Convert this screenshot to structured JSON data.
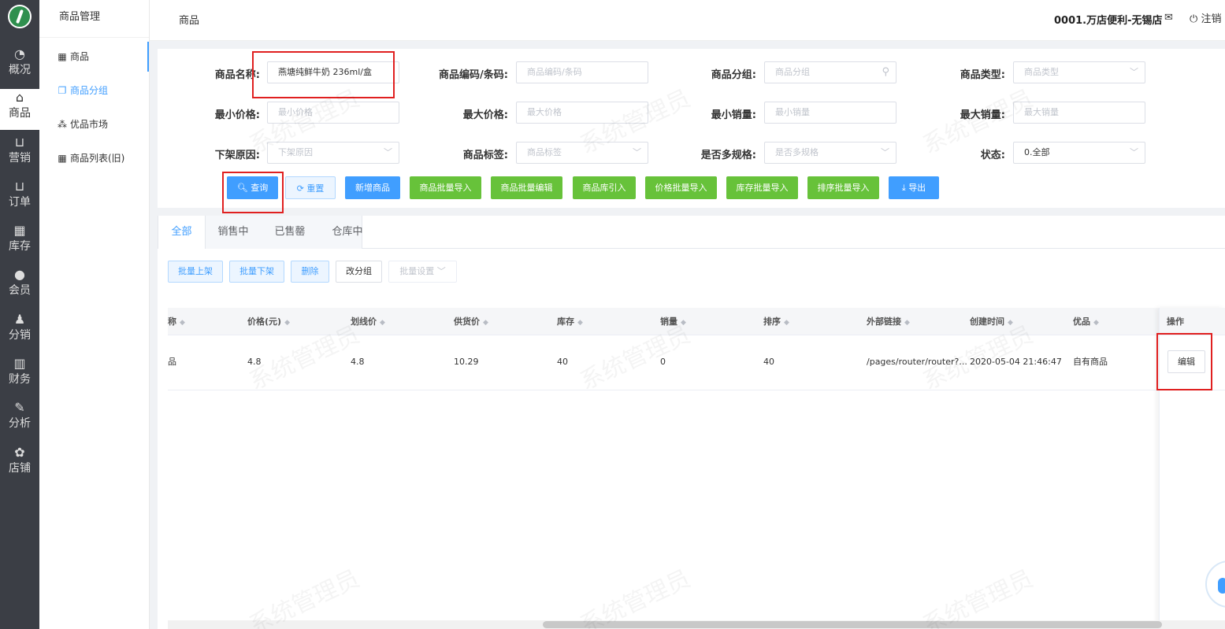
{
  "rail": [
    {
      "label": "概况",
      "icon": "dashboard-icon"
    },
    {
      "label": "商品",
      "icon": "product-icon"
    },
    {
      "label": "营销",
      "icon": "cart-icon"
    },
    {
      "label": "订单",
      "icon": "order-cart-icon"
    },
    {
      "label": "库存",
      "icon": "inventory-icon"
    },
    {
      "label": "会员",
      "icon": "member-icon"
    },
    {
      "label": "分销",
      "icon": "distribution-icon"
    },
    {
      "label": "财务",
      "icon": "finance-icon"
    },
    {
      "label": "分析",
      "icon": "analysis-icon"
    },
    {
      "label": "店铺",
      "icon": "store-gear-icon"
    }
  ],
  "sidebar": {
    "title": "商品管理",
    "items": [
      {
        "label": "商品",
        "icon": "grid-icon"
      },
      {
        "label": "商品分组",
        "icon": "copy-icon"
      },
      {
        "label": "优品市场",
        "icon": "tree-icon"
      },
      {
        "label": "商品列表(旧)",
        "icon": "grid-icon"
      }
    ]
  },
  "header": {
    "title": "商品",
    "store": "0001.万店便利-无锡店",
    "logout": "注销"
  },
  "filters": {
    "name_label": "商品名称:",
    "name_value": "燕塘纯鲜牛奶 236ml/盒",
    "code_label": "商品编码/条码:",
    "code_placeholder": "商品编码/条码",
    "group_label": "商品分组:",
    "group_placeholder": "商品分组",
    "type_label": "商品类型:",
    "type_placeholder": "商品类型",
    "min_price_label": "最小价格:",
    "min_price_placeholder": "最小价格",
    "max_price_label": "最大价格:",
    "max_price_placeholder": "最大价格",
    "min_sales_label": "最小销量:",
    "min_sales_placeholder": "最小销量",
    "max_sales_label": "最大销量:",
    "max_sales_placeholder": "最大销量",
    "offshelf_label": "下架原因:",
    "offshelf_placeholder": "下架原因",
    "tag_label": "商品标签:",
    "tag_placeholder": "商品标签",
    "multispec_label": "是否多规格:",
    "multispec_placeholder": "是否多规格",
    "status_label": "状态:",
    "status_value": "0.全部"
  },
  "actions": {
    "query": "查询",
    "reset": "重置",
    "add": "新增商品",
    "batch_import": "商品批量导入",
    "batch_edit": "商品批量编辑",
    "library_import": "商品库引入",
    "price_import": "价格批量导入",
    "stock_import": "库存批量导入",
    "sort_import": "排序批量导入",
    "export": "导出"
  },
  "tabs": [
    "全部",
    "销售中",
    "已售罄",
    "仓库中"
  ],
  "bulk": {
    "on_shelf": "批量上架",
    "off_shelf": "批量下架",
    "delete": "删除",
    "regroup": "改分组",
    "settings": "批量设置"
  },
  "table": {
    "columns": [
      "称",
      "价格(元)",
      "划线价",
      "供货价",
      "库存",
      "销量",
      "排序",
      "外部链接",
      "创建时间",
      "优品",
      "操作"
    ],
    "rows": [
      {
        "name": "品",
        "price": "4.8",
        "strike_price": "4.8",
        "supply_price": "10.29",
        "stock": "40",
        "sales": "0",
        "sort": "40",
        "link": "/pages/router/router?...",
        "created": "2020-05-04 21:46:47",
        "premium": "自有商品",
        "action": "编辑"
      }
    ]
  },
  "watermark": "系统管理员"
}
